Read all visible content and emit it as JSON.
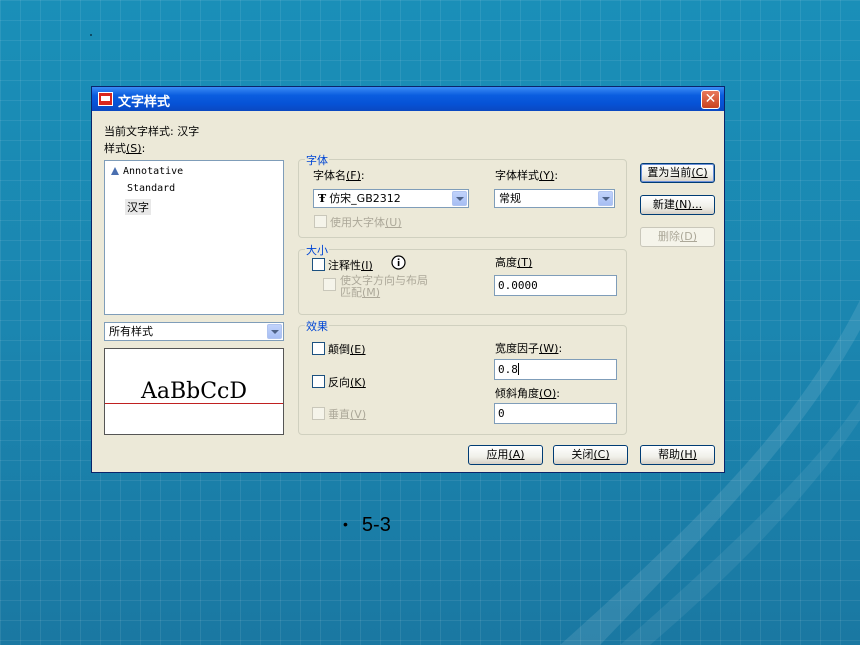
{
  "dialog": {
    "title": "文字样式",
    "current_style_prefix": "当前文字样式:",
    "current_style_value": "汉字",
    "styles_label": "样式",
    "styles_hotkey": "(S)",
    "styles_suffix": ":",
    "styles": [
      "Annotative",
      "Standard",
      "汉字"
    ],
    "selected_style": "汉字",
    "filter_value": "所有样式",
    "preview_text": "AaBbCcD"
  },
  "font_group": {
    "title": "字体",
    "font_name_label": "字体名",
    "font_name_hotkey": "(F)",
    "font_name_value": "仿宋_GB2312",
    "font_style_label": "字体样式",
    "font_style_hotkey": "(Y)",
    "font_style_value": "常规",
    "big_font_label": "使用大字体",
    "big_font_hotkey": "(U)"
  },
  "size_group": {
    "title": "大小",
    "annotative_label": "注释性",
    "annotative_hotkey": "(I)",
    "orient_label_line1": "使文字方向与布局",
    "orient_label_line2": "匹配",
    "orient_hotkey": "(M)",
    "height_label": "高度",
    "height_hotkey": "(T)",
    "height_value": "0.0000"
  },
  "effects_group": {
    "title": "效果",
    "upside_down_label": "颠倒",
    "upside_down_hotkey": "(E)",
    "backwards_label": "反向",
    "backwards_hotkey": "(K)",
    "vertical_label": "垂直",
    "vertical_hotkey": "(V)",
    "width_factor_label": "宽度因子",
    "width_factor_hotkey": "(W)",
    "width_factor_value": "0.8",
    "oblique_label": "倾斜角度",
    "oblique_hotkey": "(O)",
    "oblique_value": "0"
  },
  "buttons": {
    "set_current": "置为当前",
    "set_current_hotkey": "(C)",
    "new": "新建",
    "new_hotkey": "(N)...",
    "delete": "删除",
    "delete_hotkey": "(D)",
    "apply": "应用",
    "apply_hotkey": "(A)",
    "close": "关闭",
    "close_hotkey": "(C)",
    "help": "帮助",
    "help_hotkey": "(H)"
  },
  "slide": {
    "caption": "5-3"
  },
  "colors": {
    "background": "#1b86b0",
    "dialog_face": "#ece9d8",
    "titlebar": "#0a5ddf",
    "group_title": "#0046d5",
    "preview_baseline": "#c02020"
  },
  "icons": [
    "app-icon",
    "close-icon",
    "annotative-icon",
    "truetype-icon",
    "info-icon",
    "dropdown-arrow-icon"
  ]
}
